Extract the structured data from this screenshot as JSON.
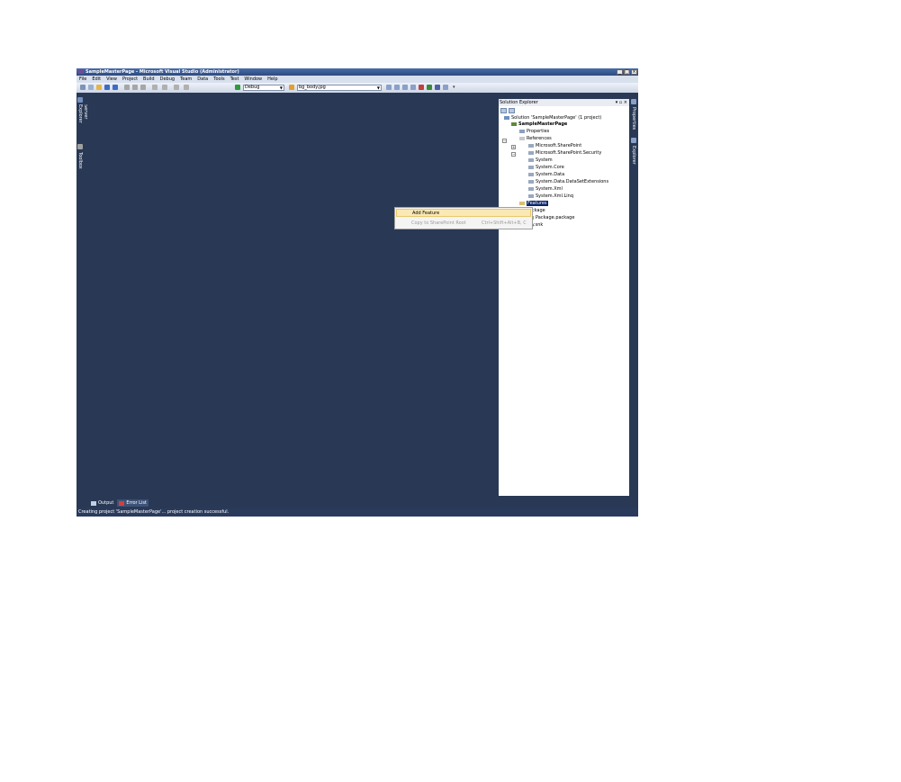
{
  "window": {
    "title": "SampleMasterPage - Microsoft Visual Studio (Administrator)",
    "controls": {
      "minimize": "_",
      "maximize": "□",
      "close": "×"
    }
  },
  "menu": [
    "File",
    "Edit",
    "View",
    "Project",
    "Build",
    "Debug",
    "Team",
    "Data",
    "Tools",
    "Test",
    "Window",
    "Help"
  ],
  "toolbar": {
    "config": "Debug",
    "find": "bg_body.jpg"
  },
  "left_tabs": {
    "server_explorer": "Server Explorer",
    "toolbox": "Toolbox"
  },
  "solution_explorer": {
    "title": "Solution Explorer",
    "header_controls": "▾ ▫ ×",
    "tree": {
      "solution": "Solution 'SampleMasterPage' (1 project)",
      "project": "SampleMasterPage",
      "properties": "Properties",
      "references": "References",
      "refs": [
        "Microsoft.SharePoint",
        "Microsoft.SharePoint.Security",
        "System",
        "System.Core",
        "System.Data",
        "System.Data.DataSetExtensions",
        "System.Xml",
        "System.Xml.Linq"
      ],
      "features": "Features",
      "package": "Package",
      "package_file": "Package.package",
      "key": "key.snk"
    }
  },
  "right_tabs": {
    "properties": "Properties",
    "solution_explorer": "Solution Explorer"
  },
  "context_menu": {
    "add_feature": "Add Feature",
    "copy_to_root": "Copy to SharePoint Root",
    "copy_shortcut": "Ctrl+Shift+Alt+B, C"
  },
  "bottom_tabs": {
    "output": "Output",
    "error_list": "Error List"
  },
  "status_bar": {
    "text": "Creating project 'SampleMasterPage'... project creation successful."
  }
}
